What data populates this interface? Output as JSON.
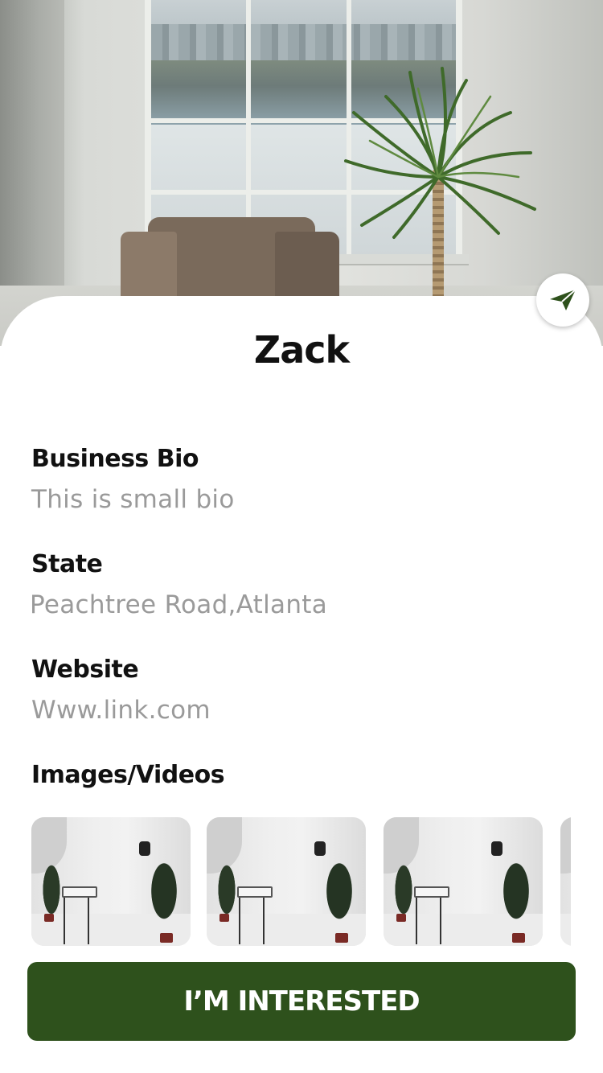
{
  "profile": {
    "name": "Zack"
  },
  "details": {
    "bio_label": "Business Bio",
    "bio_value": "This is small bio",
    "state_label": "State",
    "state_value": "Peachtree Road,Atlanta",
    "website_label": "Website",
    "website_value": "Www.link.com"
  },
  "media": {
    "label": "Images/Videos"
  },
  "actions": {
    "share_icon": "send-icon",
    "interested_label": "I’M INTERESTED"
  },
  "colors": {
    "accent": "#2e511c",
    "muted_text": "#9a9a9a",
    "heading_text": "#111111"
  }
}
